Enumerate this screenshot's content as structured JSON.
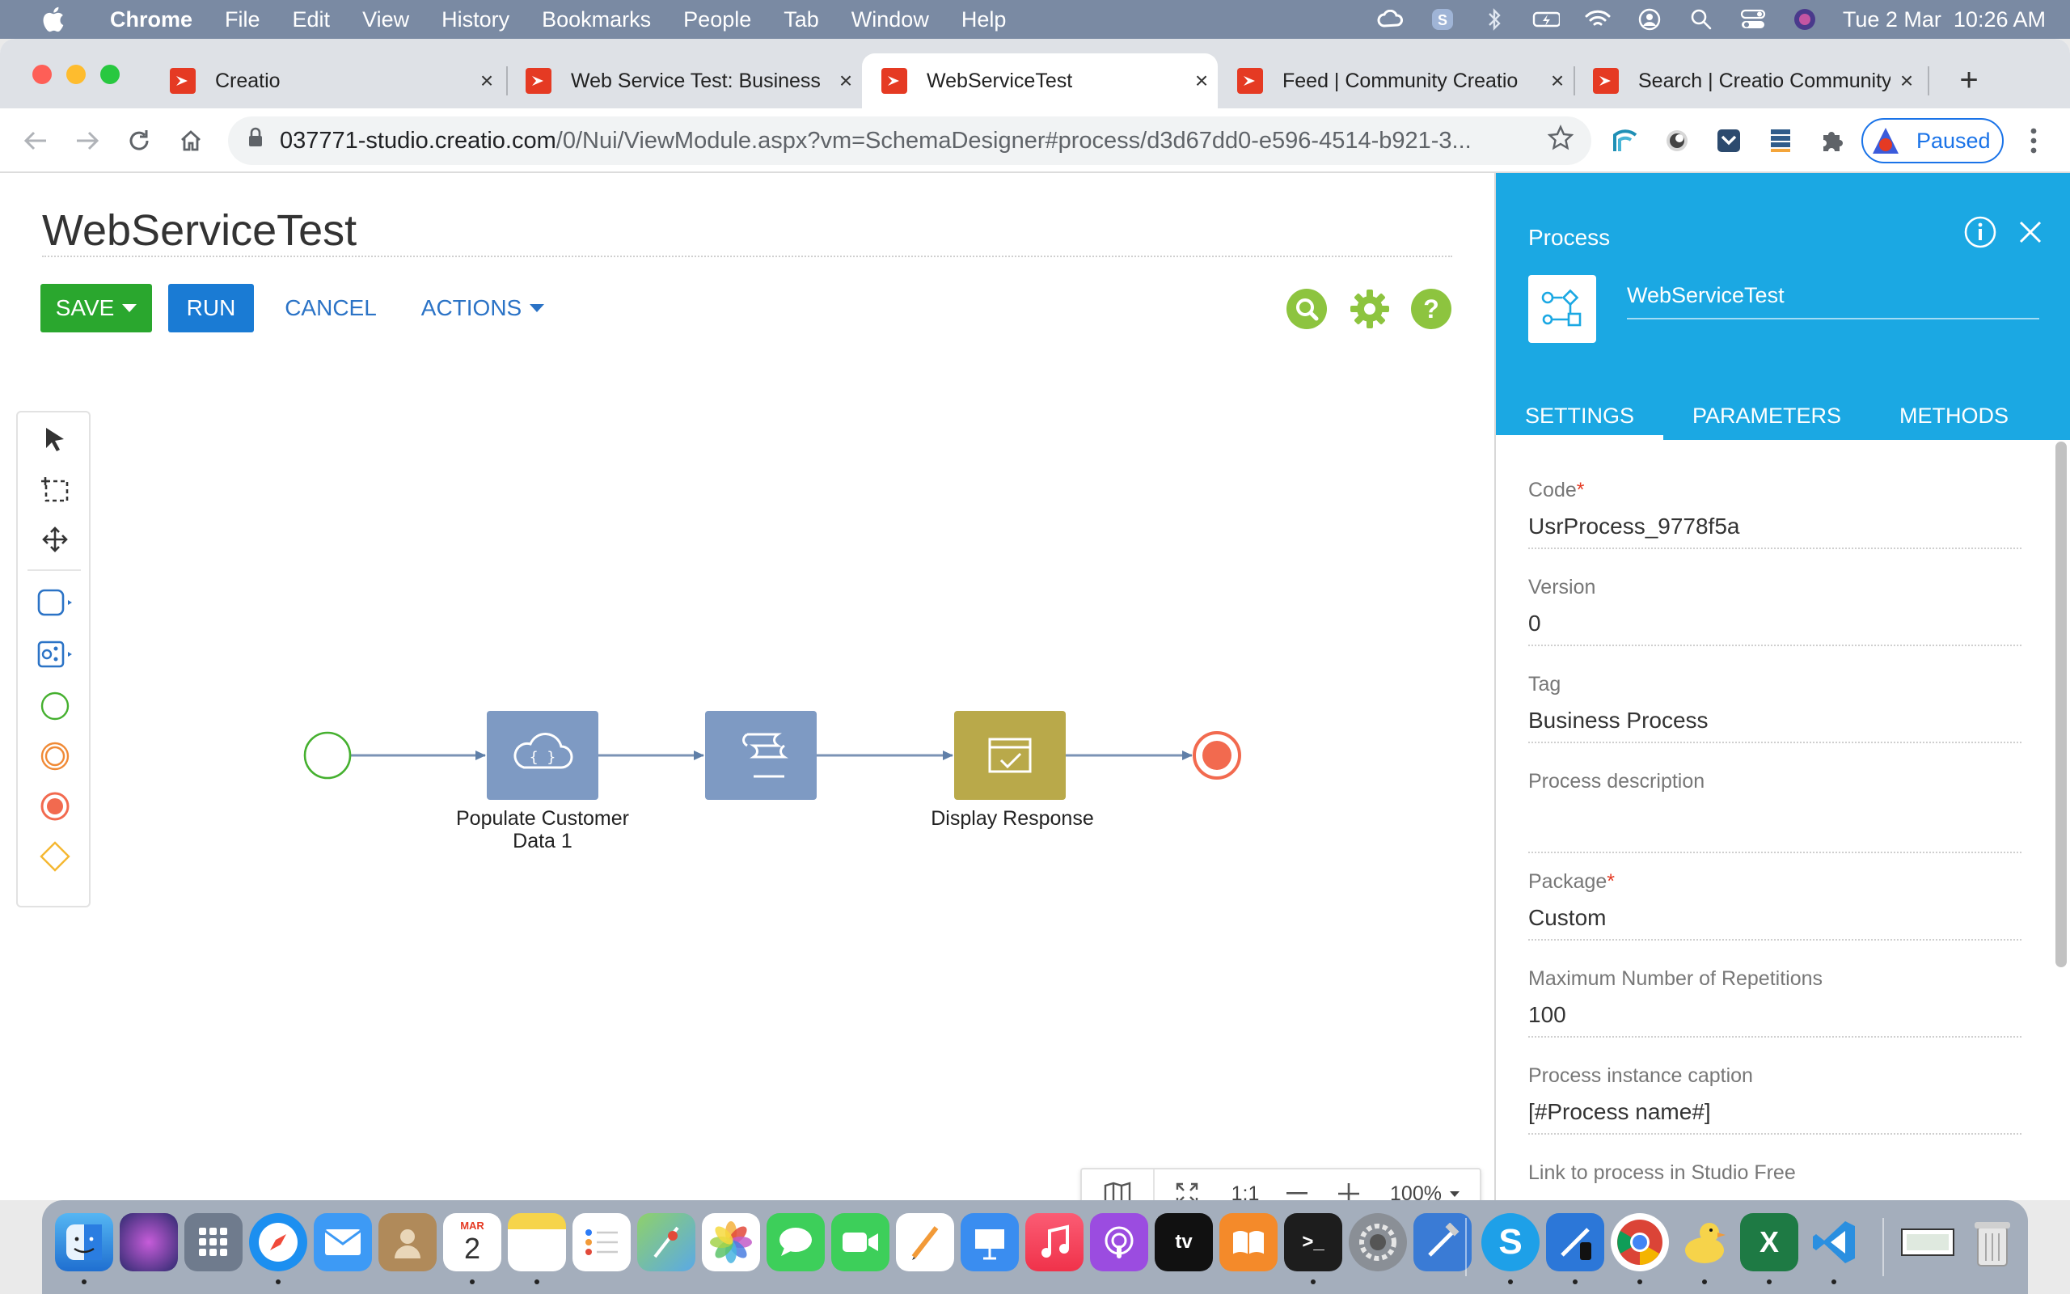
{
  "menubar": {
    "items": [
      "Chrome",
      "File",
      "Edit",
      "View",
      "History",
      "Bookmarks",
      "People",
      "Tab",
      "Window",
      "Help"
    ],
    "clock": "Tue 2 Mar  10:26 AM"
  },
  "browser": {
    "tabs": [
      {
        "title": "Creatio"
      },
      {
        "title": "Web Service Test: Business"
      },
      {
        "title": "WebServiceTest"
      },
      {
        "title": "Feed | Community Creatio"
      },
      {
        "title": "Search | Creatio Community"
      }
    ],
    "url_host": "037771-studio.creatio.com",
    "url_path": "/0/Nui/ViewModule.aspx?vm=SchemaDesigner#process/d3d67dd0-e596-4514-b921-3...",
    "profile_label": "Paused"
  },
  "designer": {
    "title": "WebServiceTest",
    "save_label": "SAVE",
    "run_label": "RUN",
    "cancel_label": "CANCEL",
    "actions_label": "ACTIONS",
    "nodes": {
      "populate_label_1": "Populate Customer",
      "populate_label_2": "Data 1",
      "display_label": "Display Response"
    },
    "zoom": {
      "one_to_one": "1:1",
      "level": "100%"
    }
  },
  "panel": {
    "title": "Process",
    "process_name": "WebServiceTest",
    "tabs": [
      "SETTINGS",
      "PARAMETERS",
      "METHODS"
    ],
    "fields": {
      "code_label": "Code",
      "code_value": "UsrProcess_9778f5a",
      "version_label": "Version",
      "version_value": "0",
      "tag_label": "Tag",
      "tag_value": "Business Process",
      "desc_label": "Process description",
      "desc_value": "",
      "package_label": "Package",
      "package_value": "Custom",
      "maxrep_label": "Maximum Number of Repetitions",
      "maxrep_value": "100",
      "caption_label": "Process instance caption",
      "caption_value": "[#Process name#]",
      "link_label": "Link to process in Studio Free"
    },
    "required_mark": "*"
  },
  "dock": {
    "calendar_month": "MAR",
    "calendar_day": "2"
  },
  "colors": {
    "accent": "#1ba8e3",
    "save": "#2aa72e",
    "run": "#1a7bd4",
    "task_node": "#7e9ac3",
    "display_node": "#b9a94a",
    "end_event": "#f26a4f"
  }
}
